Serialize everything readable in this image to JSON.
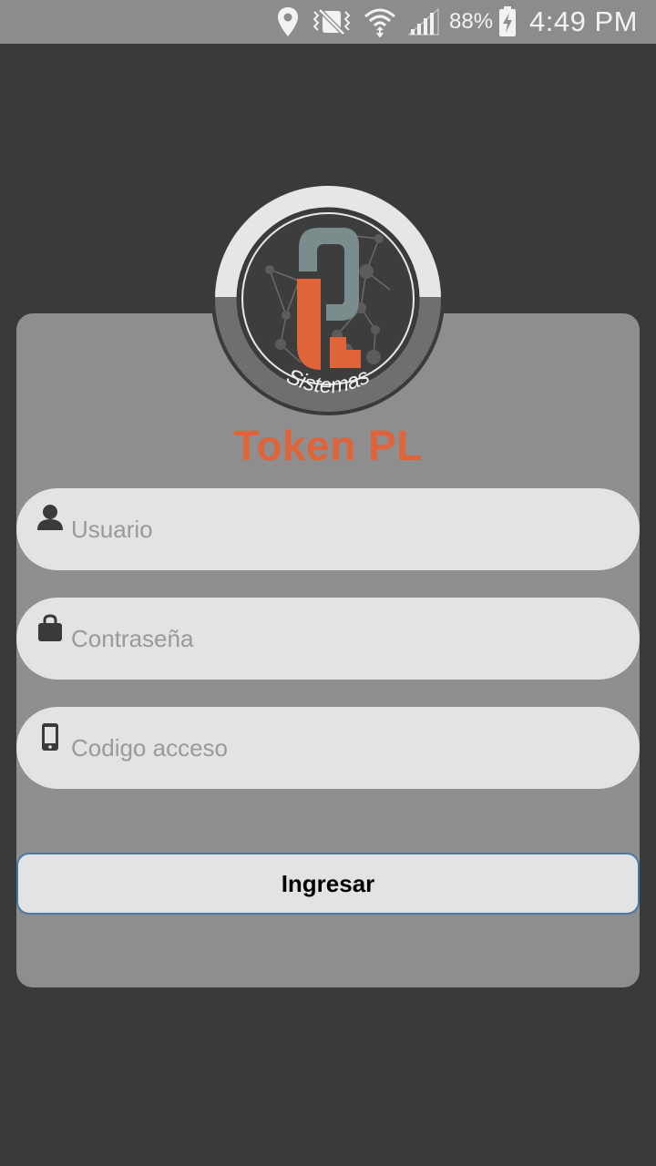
{
  "status_bar": {
    "battery_percent": "88%",
    "time": "4:49 PM",
    "icons": [
      "location-icon",
      "vibrate-icon",
      "wifi-icon",
      "signal-icon",
      "battery-charging-icon"
    ]
  },
  "logo": {
    "brand_text": "Sistemas",
    "colors": {
      "orange": "#e0643a",
      "slate": "#7b8c8c",
      "ring_light": "#e6e6e6",
      "ring_dark": "#6f6f6f"
    }
  },
  "app": {
    "title": "Token PL"
  },
  "form": {
    "username": {
      "placeholder": "Usuario",
      "value": "",
      "icon": "user-icon"
    },
    "password": {
      "placeholder": "Contraseña",
      "value": "",
      "icon": "lock-icon"
    },
    "access_code": {
      "placeholder": "Codigo acceso",
      "value": "",
      "icon": "phone-icon"
    },
    "submit_label": "Ingresar"
  },
  "colors": {
    "background": "#3a3a3a",
    "card": "#8e8e8e",
    "field": "#e3e3e3",
    "accent": "#e0643a",
    "button_border": "#4a78a8"
  }
}
